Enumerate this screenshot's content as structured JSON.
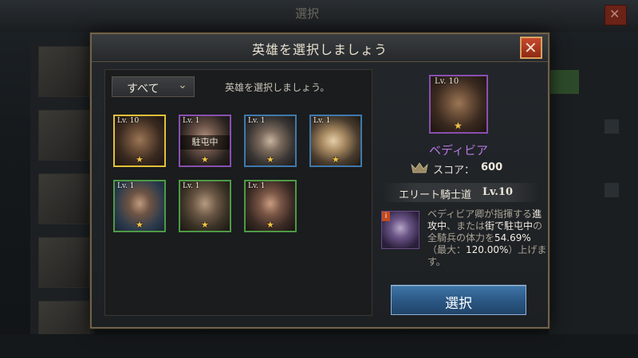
{
  "background": {
    "title": "選択"
  },
  "modal": {
    "title": "英雄を選択しましょう",
    "close_icon": "close-x-icon"
  },
  "filter": {
    "selected": "すべて",
    "hint": "英雄を選択しましょう。"
  },
  "heroes": [
    {
      "level": "Lv. 10",
      "rarity": "gold",
      "stars": "★",
      "status": ""
    },
    {
      "level": "Lv. 1",
      "rarity": "purple",
      "stars": "★",
      "status": "駐屯中"
    },
    {
      "level": "Lv. 1",
      "rarity": "blue",
      "stars": "★",
      "status": ""
    },
    {
      "level": "Lv. 1",
      "rarity": "blue",
      "stars": "★",
      "status": ""
    },
    {
      "level": "Lv. 1",
      "rarity": "green",
      "stars": "★",
      "status": ""
    },
    {
      "level": "Lv. 1",
      "rarity": "green",
      "stars": "★",
      "status": ""
    },
    {
      "level": "Lv. 1",
      "rarity": "green",
      "stars": "★",
      "status": ""
    }
  ],
  "selected_hero": {
    "level": "Lv. 10",
    "stars": "★",
    "name": "ベディビア",
    "score_label": "スコア：",
    "score_value": "600",
    "skill_name": "エリート騎士道",
    "skill_level": "Lv.10",
    "skill_badge": "i",
    "skill_desc_1": "ベディビア卿が指揮する",
    "skill_desc_2": "進攻中",
    "skill_desc_3": "、または",
    "skill_desc_4": "街で駐屯中",
    "skill_desc_5": "の全騎兵の体力を",
    "skill_desc_6": "54.69%",
    "skill_desc_7": "（最大：",
    "skill_desc_8": "120.00%",
    "skill_desc_9": "）上げます。"
  },
  "select_button": "選択",
  "colors": {
    "gold": "#e2c038",
    "purple": "#8a4fb0",
    "blue": "#3f79ac",
    "green": "#4e9a45",
    "name": "#b676e3",
    "button": "#2a5683"
  }
}
